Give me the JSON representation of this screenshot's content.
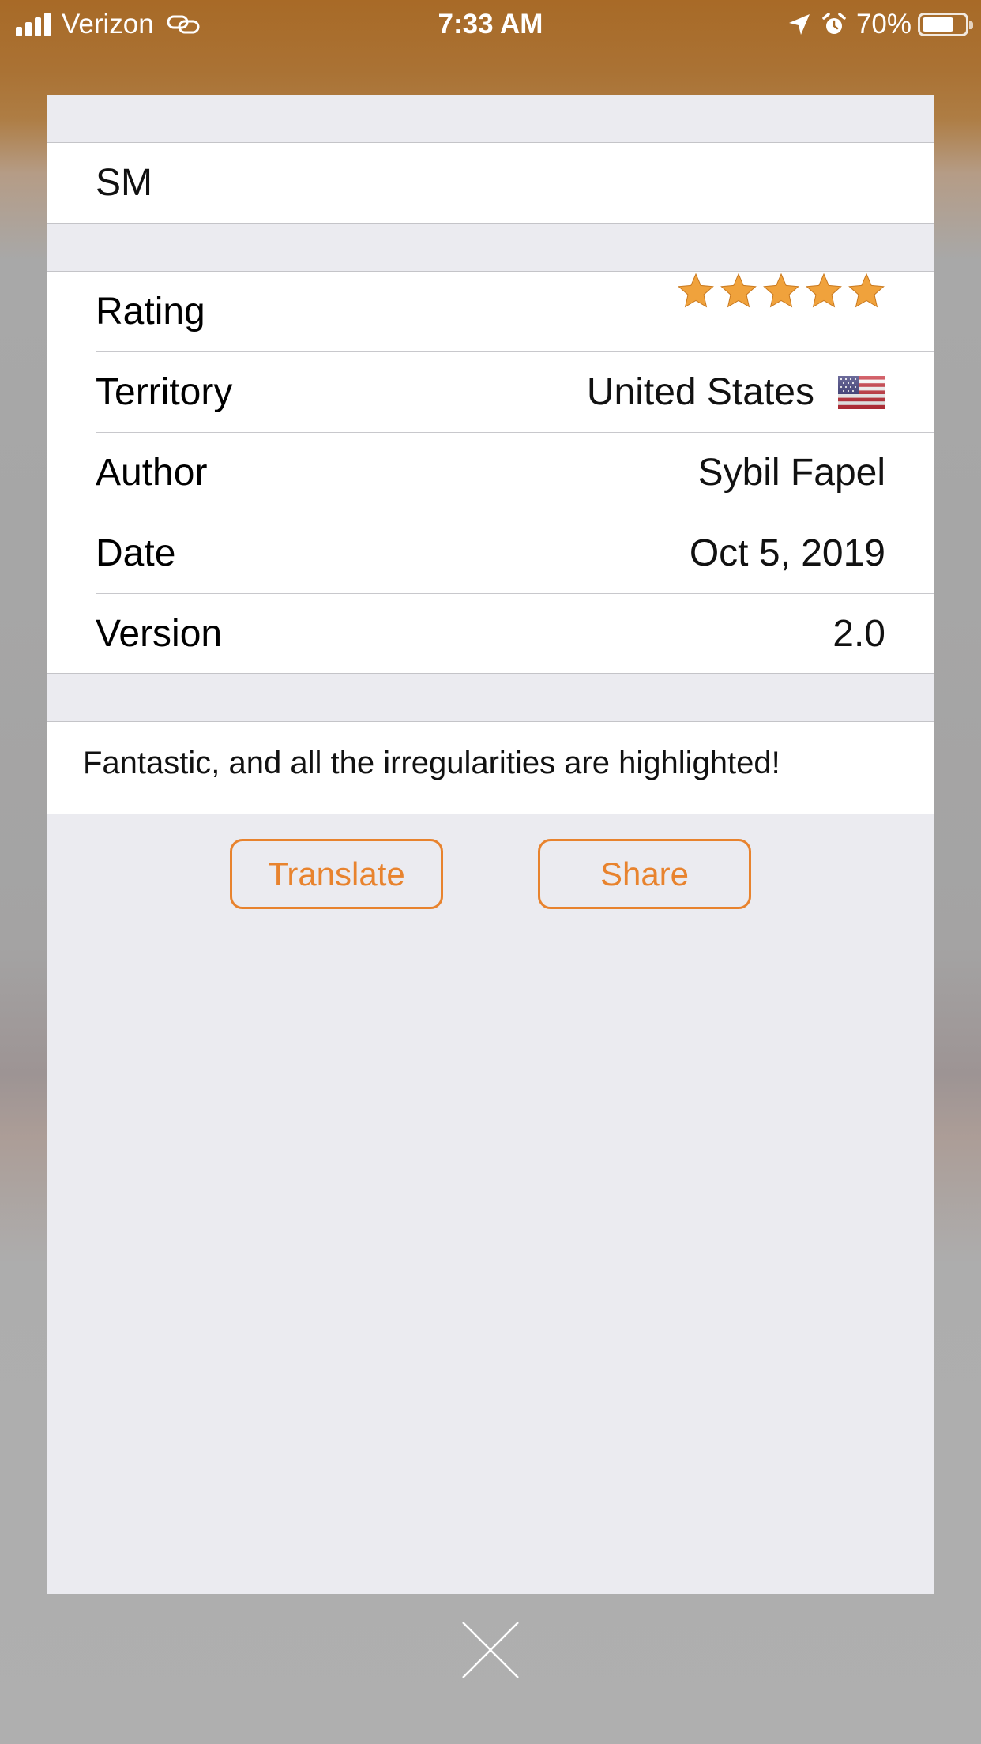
{
  "status_bar": {
    "carrier": "Verizon",
    "time": "7:33 AM",
    "battery_percent": "70%",
    "signal_icon": "cellular-signal-icon",
    "link_icon": "personal-hotspot-link-icon",
    "location_icon": "location-arrow-icon",
    "alarm_icon": "alarm-clock-icon",
    "battery_icon": "battery-icon",
    "battery_level": 0.7
  },
  "review": {
    "title": "SM",
    "rating_label": "Rating",
    "rating": 5,
    "rating_max": 5,
    "territory_label": "Territory",
    "territory": "United States",
    "territory_flag_icon": "us-flag-icon",
    "author_label": "Author",
    "author": "Sybil Fapel",
    "date_label": "Date",
    "date": "Oct 5, 2019",
    "version_label": "Version",
    "version": "2.0",
    "body": "Fantastic, and all the irregularities are highlighted!"
  },
  "actions": {
    "translate_label": "Translate",
    "share_label": "Share",
    "close_icon": "close-x-icon"
  },
  "colors": {
    "accent": "#e8832e",
    "star": "#f0a23c",
    "card_background": "#ebebf0",
    "status_bar_background": "#a86a27"
  }
}
